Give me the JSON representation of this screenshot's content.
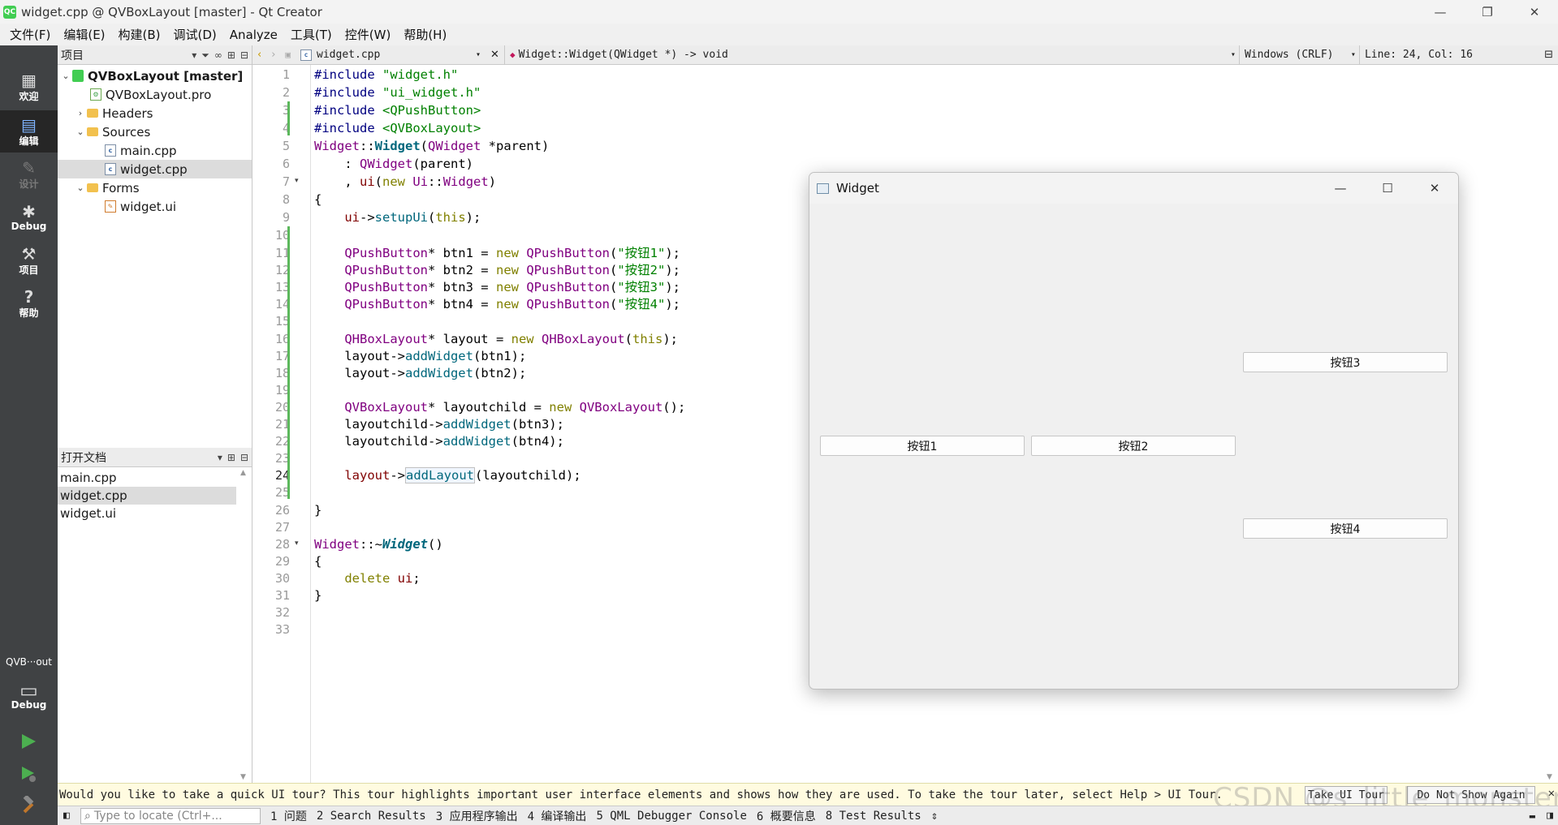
{
  "window": {
    "title": "widget.cpp @ QVBoxLayout [master] - Qt Creator",
    "app_icon": "QC",
    "minimize_glyph": "—",
    "restore_glyph": "❐",
    "close_glyph": "✕"
  },
  "menu": [
    "文件(F)",
    "编辑(E)",
    "构建(B)",
    "调试(D)",
    "Analyze",
    "工具(T)",
    "控件(W)",
    "帮助(H)"
  ],
  "modes": {
    "welcome": "欢迎",
    "edit": "编辑",
    "design": "设计",
    "debug": "Debug",
    "projects": "项目",
    "help": "帮助"
  },
  "kit": {
    "project_short": "QVB···out",
    "build_config": "Debug"
  },
  "project_panel": {
    "title": "项目",
    "tree": {
      "root": "QVBoxLayout [master]",
      "pro_file": "QVBoxLayout.pro",
      "headers": "Headers",
      "sources": "Sources",
      "source_files": [
        "main.cpp",
        "widget.cpp"
      ],
      "forms": "Forms",
      "form_files": [
        "widget.ui"
      ]
    }
  },
  "open_docs_panel": {
    "title": "打开文档",
    "files": [
      "main.cpp",
      "widget.cpp",
      "widget.ui"
    ]
  },
  "editor_toolbar": {
    "file_name": "widget.cpp",
    "symbol": "Widget::Widget(QWidget *) -> void",
    "line_endings": "Windows (CRLF)",
    "cursor_position": "Line: 24, Col: 16"
  },
  "editor": {
    "current_line": 24,
    "lines": [
      "#include \"widget.h\"",
      "#include \"ui_widget.h\"",
      "#include <QPushButton>",
      "#include <QVBoxLayout>",
      "Widget::Widget(QWidget *parent)",
      "    : QWidget(parent)",
      "    , ui(new Ui::Widget)",
      "{",
      "    ui->setupUi(this);",
      "",
      "    QPushButton* btn1 = new QPushButton(\"按钮1\");",
      "    QPushButton* btn2 = new QPushButton(\"按钮2\");",
      "    QPushButton* btn3 = new QPushButton(\"按钮3\");",
      "    QPushButton* btn4 = new QPushButton(\"按钮4\");",
      "",
      "    QHBoxLayout* layout = new QHBoxLayout(this);",
      "    layout->addWidget(btn1);",
      "    layout->addWidget(btn2);",
      "",
      "    QVBoxLayout* layoutchild = new QVBoxLayout();",
      "    layoutchild->addWidget(btn3);",
      "    layoutchild->addWidget(btn4);",
      "",
      "    layout->addLayout(layoutchild);",
      "",
      "}",
      "",
      "Widget::~Widget()",
      "{",
      "    delete ui;",
      "}",
      "",
      ""
    ]
  },
  "widget_window": {
    "title": "Widget",
    "buttons": [
      "按钮1",
      "按钮2",
      "按钮3",
      "按钮4"
    ]
  },
  "tour_bar": {
    "message": "Would you like to take a quick UI tour? This tour highlights important user interface elements and shows how they are used. To take the tour later, select Help > UI Tour.",
    "take_tour": "Take UI Tour",
    "dont_show": "Do Not Show Again",
    "close_glyph": "✕"
  },
  "watermark": "CSDN @s_little_monster",
  "status_bar": {
    "locator_placeholder": "Type to locate (Ctrl+...",
    "panes": [
      "1 问题",
      "2 Search Results",
      "3 应用程序输出",
      "4 编译输出",
      "5 QML Debugger Console",
      "6 概要信息",
      "8 Test Results"
    ],
    "more_glyph": "⇕"
  }
}
